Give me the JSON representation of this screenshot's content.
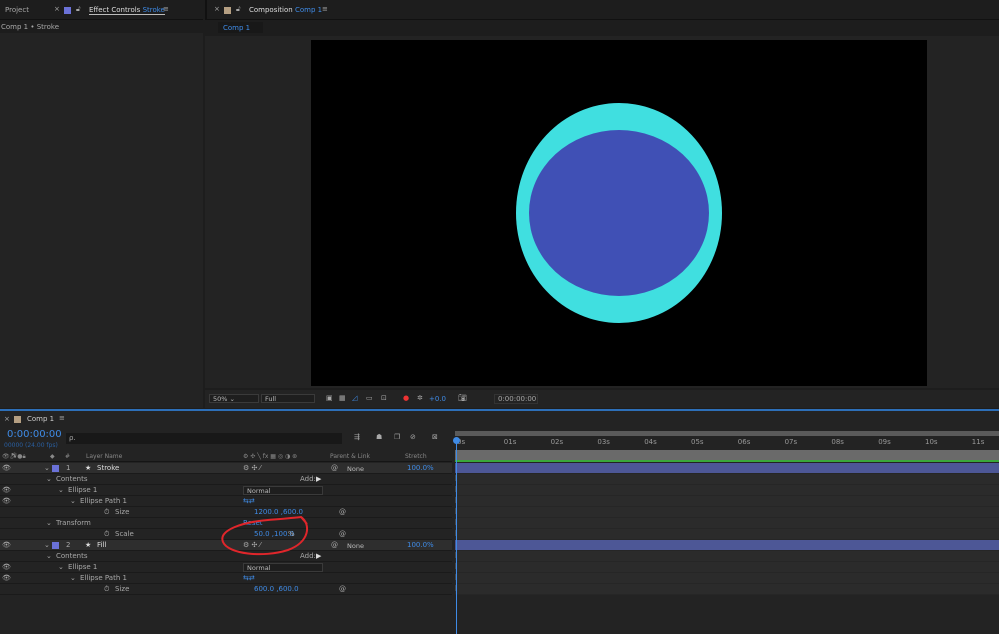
{
  "panels": {
    "project_tab": "Project",
    "effect_tab": "Effect Controls",
    "effect_layer": "Stroke",
    "effect_breadcrumb": "Comp 1 • Stroke",
    "comp_tab": "Composition",
    "comp_name": "Comp 1",
    "comp_subtab": "Comp 1"
  },
  "viewer": {
    "zoom": "50%",
    "resolution": "Full",
    "exposure": "+0.0",
    "timecode": "0:00:00:00",
    "colors": {
      "outer": "#40dfe0",
      "inner": "#4050b5",
      "bg": "#000000"
    }
  },
  "timeline": {
    "tab": "Comp 1",
    "timecode": "0:00:00:00",
    "frames": "00000 (24.00 fps)",
    "search_placeholder": "ρ.",
    "headers": {
      "num": "#",
      "layer_name": "Layer Name",
      "parent": "Parent & Link",
      "stretch": "Stretch"
    },
    "ticks": [
      "0s",
      "01s",
      "02s",
      "03s",
      "04s",
      "05s",
      "06s",
      "07s",
      "08s",
      "09s",
      "10s",
      "11s"
    ],
    "rows": [
      {
        "type": "layer",
        "num": "1",
        "name": "Stroke",
        "parent": "None",
        "stretch": "100.0%"
      },
      {
        "type": "group",
        "name": "Contents",
        "add": "Add:",
        "indent": 1
      },
      {
        "type": "item",
        "name": "Ellipse 1",
        "mode": "Normal",
        "indent": 2,
        "eye": true
      },
      {
        "type": "item",
        "name": "Ellipse Path 1",
        "indent": 3,
        "eye": true,
        "path": true
      },
      {
        "type": "prop",
        "name": "Size",
        "value": "1200.0 ,600.0",
        "indent": 4
      },
      {
        "type": "group",
        "name": "Transform",
        "reset": "Reset",
        "indent": 1
      },
      {
        "type": "prop",
        "name": "Scale",
        "value": "50.0 ,100.0",
        "unit": "%",
        "indent": 4
      },
      {
        "type": "layer",
        "num": "2",
        "name": "Fill",
        "parent": "None",
        "stretch": "100.0%"
      },
      {
        "type": "group",
        "name": "Contents",
        "add": "Add:",
        "indent": 1
      },
      {
        "type": "item",
        "name": "Ellipse 1",
        "mode": "Normal",
        "indent": 2,
        "eye": true
      },
      {
        "type": "item",
        "name": "Ellipse Path 1",
        "indent": 3,
        "eye": true,
        "path": true
      },
      {
        "type": "prop",
        "name": "Size",
        "value": "600.0 ,600.0",
        "indent": 4
      }
    ]
  },
  "annotation": {
    "color": "#e0262b"
  }
}
